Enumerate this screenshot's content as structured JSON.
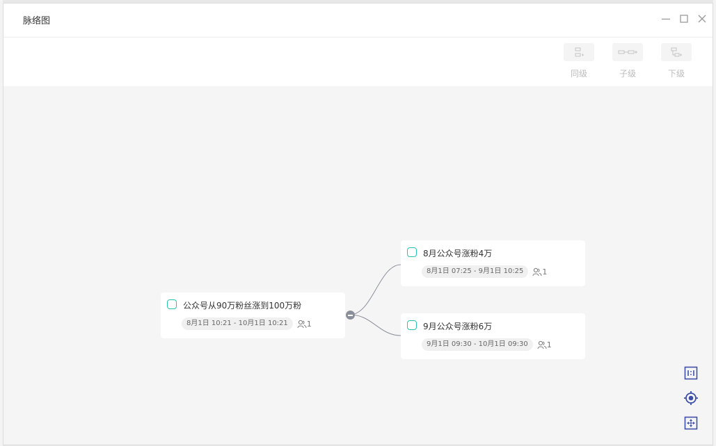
{
  "window": {
    "title": "脉络图"
  },
  "toolbar": {
    "items": [
      {
        "label": "同级",
        "icon": "sibling-node-icon"
      },
      {
        "label": "子级",
        "icon": "child-node-icon"
      },
      {
        "label": "下级",
        "icon": "subordinate-node-icon"
      }
    ]
  },
  "mindmap": {
    "root": {
      "title": "公众号从90万粉丝涨到100万粉",
      "date_range": "8月1日 10:21 - 10月1日 10:21",
      "member_count": "1"
    },
    "children": [
      {
        "title": "8月公众号涨粉4万",
        "date_range": "8月1日 07:25 - 9月1日 10:25",
        "member_count": "1"
      },
      {
        "title": "9月公众号涨粉6万",
        "date_range": "9月1日 09:30 - 10月1日 09:30",
        "member_count": "1"
      }
    ]
  },
  "zoom_controls": [
    "actual-size-icon",
    "locate-center-icon",
    "fit-view-icon"
  ],
  "colors": {
    "accent": "#25c2b4",
    "control_blue": "#3e4fa8",
    "canvas_bg": "#f5f5f5",
    "connector": "#8a8f9a"
  }
}
